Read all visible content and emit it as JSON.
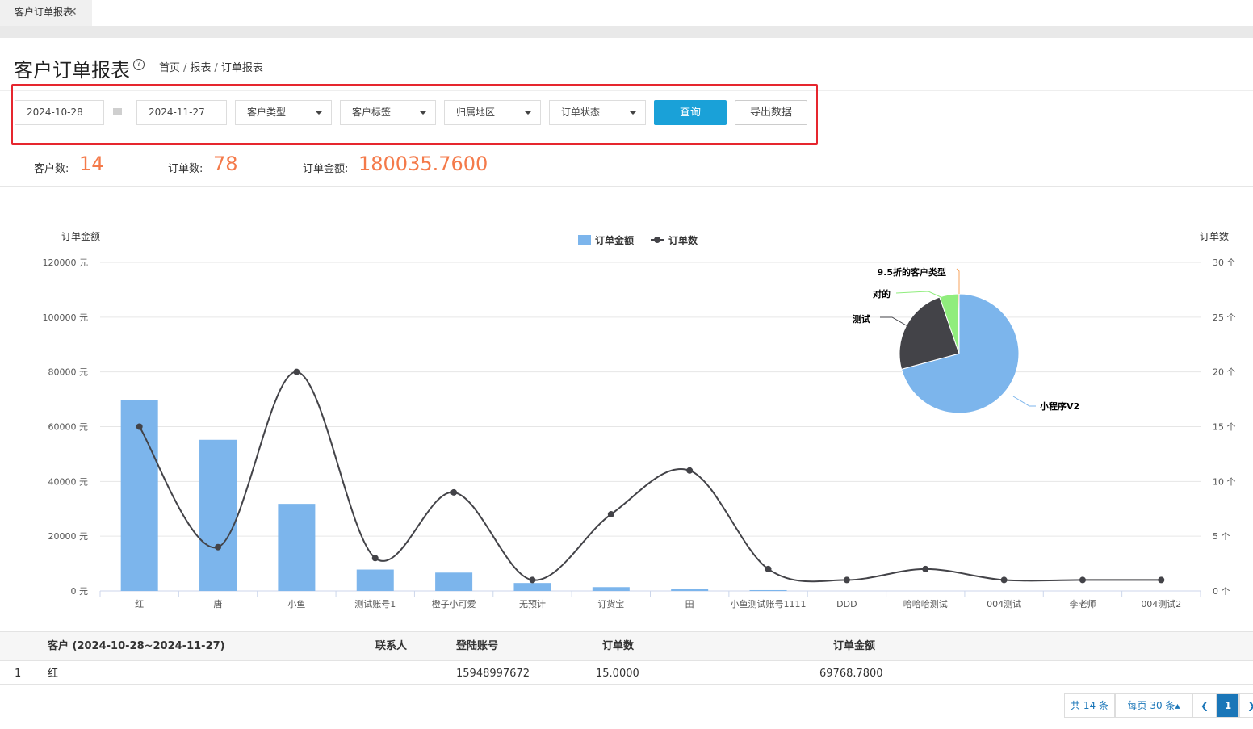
{
  "tab": {
    "title": "客户订单报表"
  },
  "header": {
    "title": "客户订单报表",
    "breadcrumb": [
      "首页",
      "报表",
      "订单报表"
    ]
  },
  "filters": {
    "start_date": "2024-10-28",
    "end_date": "2024-11-27",
    "customer_type": "客户类型",
    "customer_tag": "客户标签",
    "region": "归属地区",
    "order_status": "订单状态",
    "query_label": "查询",
    "export_label": "导出数据"
  },
  "stats": {
    "customer_count_label": "客户数:",
    "customer_count": "14",
    "order_count_label": "订单数:",
    "order_count": "78",
    "order_amount_label": "订单金额:",
    "order_amount": "180035.7600"
  },
  "chart_data": [
    {
      "type": "bar",
      "ylabel": "订单金额",
      "y2label": "订单数",
      "ylim": [
        0,
        120000
      ],
      "y2lim": [
        0,
        30
      ],
      "yticks": [
        "0 元",
        "20000 元",
        "40000 元",
        "60000 元",
        "80000 元",
        "100000 元",
        "120000 元"
      ],
      "y2ticks": [
        "0 个",
        "5 个",
        "10 个",
        "15 个",
        "20 个",
        "25 个",
        "30 个"
      ],
      "legend": [
        "订单金额",
        "订单数"
      ],
      "legend_position": "top-center",
      "grid": true,
      "categories": [
        "红",
        "唐",
        "小鱼",
        "测试账号1",
        "橙子小可爱",
        "无预计",
        "订货宝",
        "田",
        "小鱼测试账号1111",
        "DDD",
        "哈哈哈测试",
        "004测试",
        "李老师",
        "004测试2"
      ],
      "series": [
        {
          "name": "订单金额",
          "type": "bar",
          "axis": "left",
          "values": [
            69768.78,
            55200,
            31800,
            7800,
            6700,
            2900,
            1400,
            600,
            300,
            0,
            0,
            0,
            0,
            0
          ]
        },
        {
          "name": "订单数",
          "type": "line",
          "axis": "right",
          "values": [
            15,
            4,
            20,
            3,
            9,
            1,
            7,
            11,
            2,
            1,
            2,
            1,
            1,
            1
          ]
        }
      ],
      "colors": {
        "bar": "#7cb5ec",
        "line": "#434348"
      }
    },
    {
      "type": "pie",
      "slices": [
        {
          "label": "小程序V2",
          "value": 71,
          "color": "#7cb5ec"
        },
        {
          "label": "测试",
          "value": 24,
          "color": "#434348"
        },
        {
          "label": "对的",
          "value": 5,
          "color": "#90ed7d"
        },
        {
          "label": "9.5折的客户类型",
          "value": 0.3,
          "color": "#f7a35c"
        }
      ]
    }
  ],
  "table": {
    "headers": {
      "customer": "客户 (2024-10-28~2024-11-27)",
      "contact": "联系人",
      "account": "登陆账号",
      "orders": "订单数",
      "amount": "订单金额"
    },
    "rows": [
      {
        "index": "1",
        "customer": "红",
        "contact": "",
        "account": "15948997672",
        "orders": "15.0000",
        "amount": "69768.7800"
      }
    ]
  },
  "pager": {
    "total": "共 14 条",
    "per_page": "每页  30  条",
    "current_page": "1"
  }
}
